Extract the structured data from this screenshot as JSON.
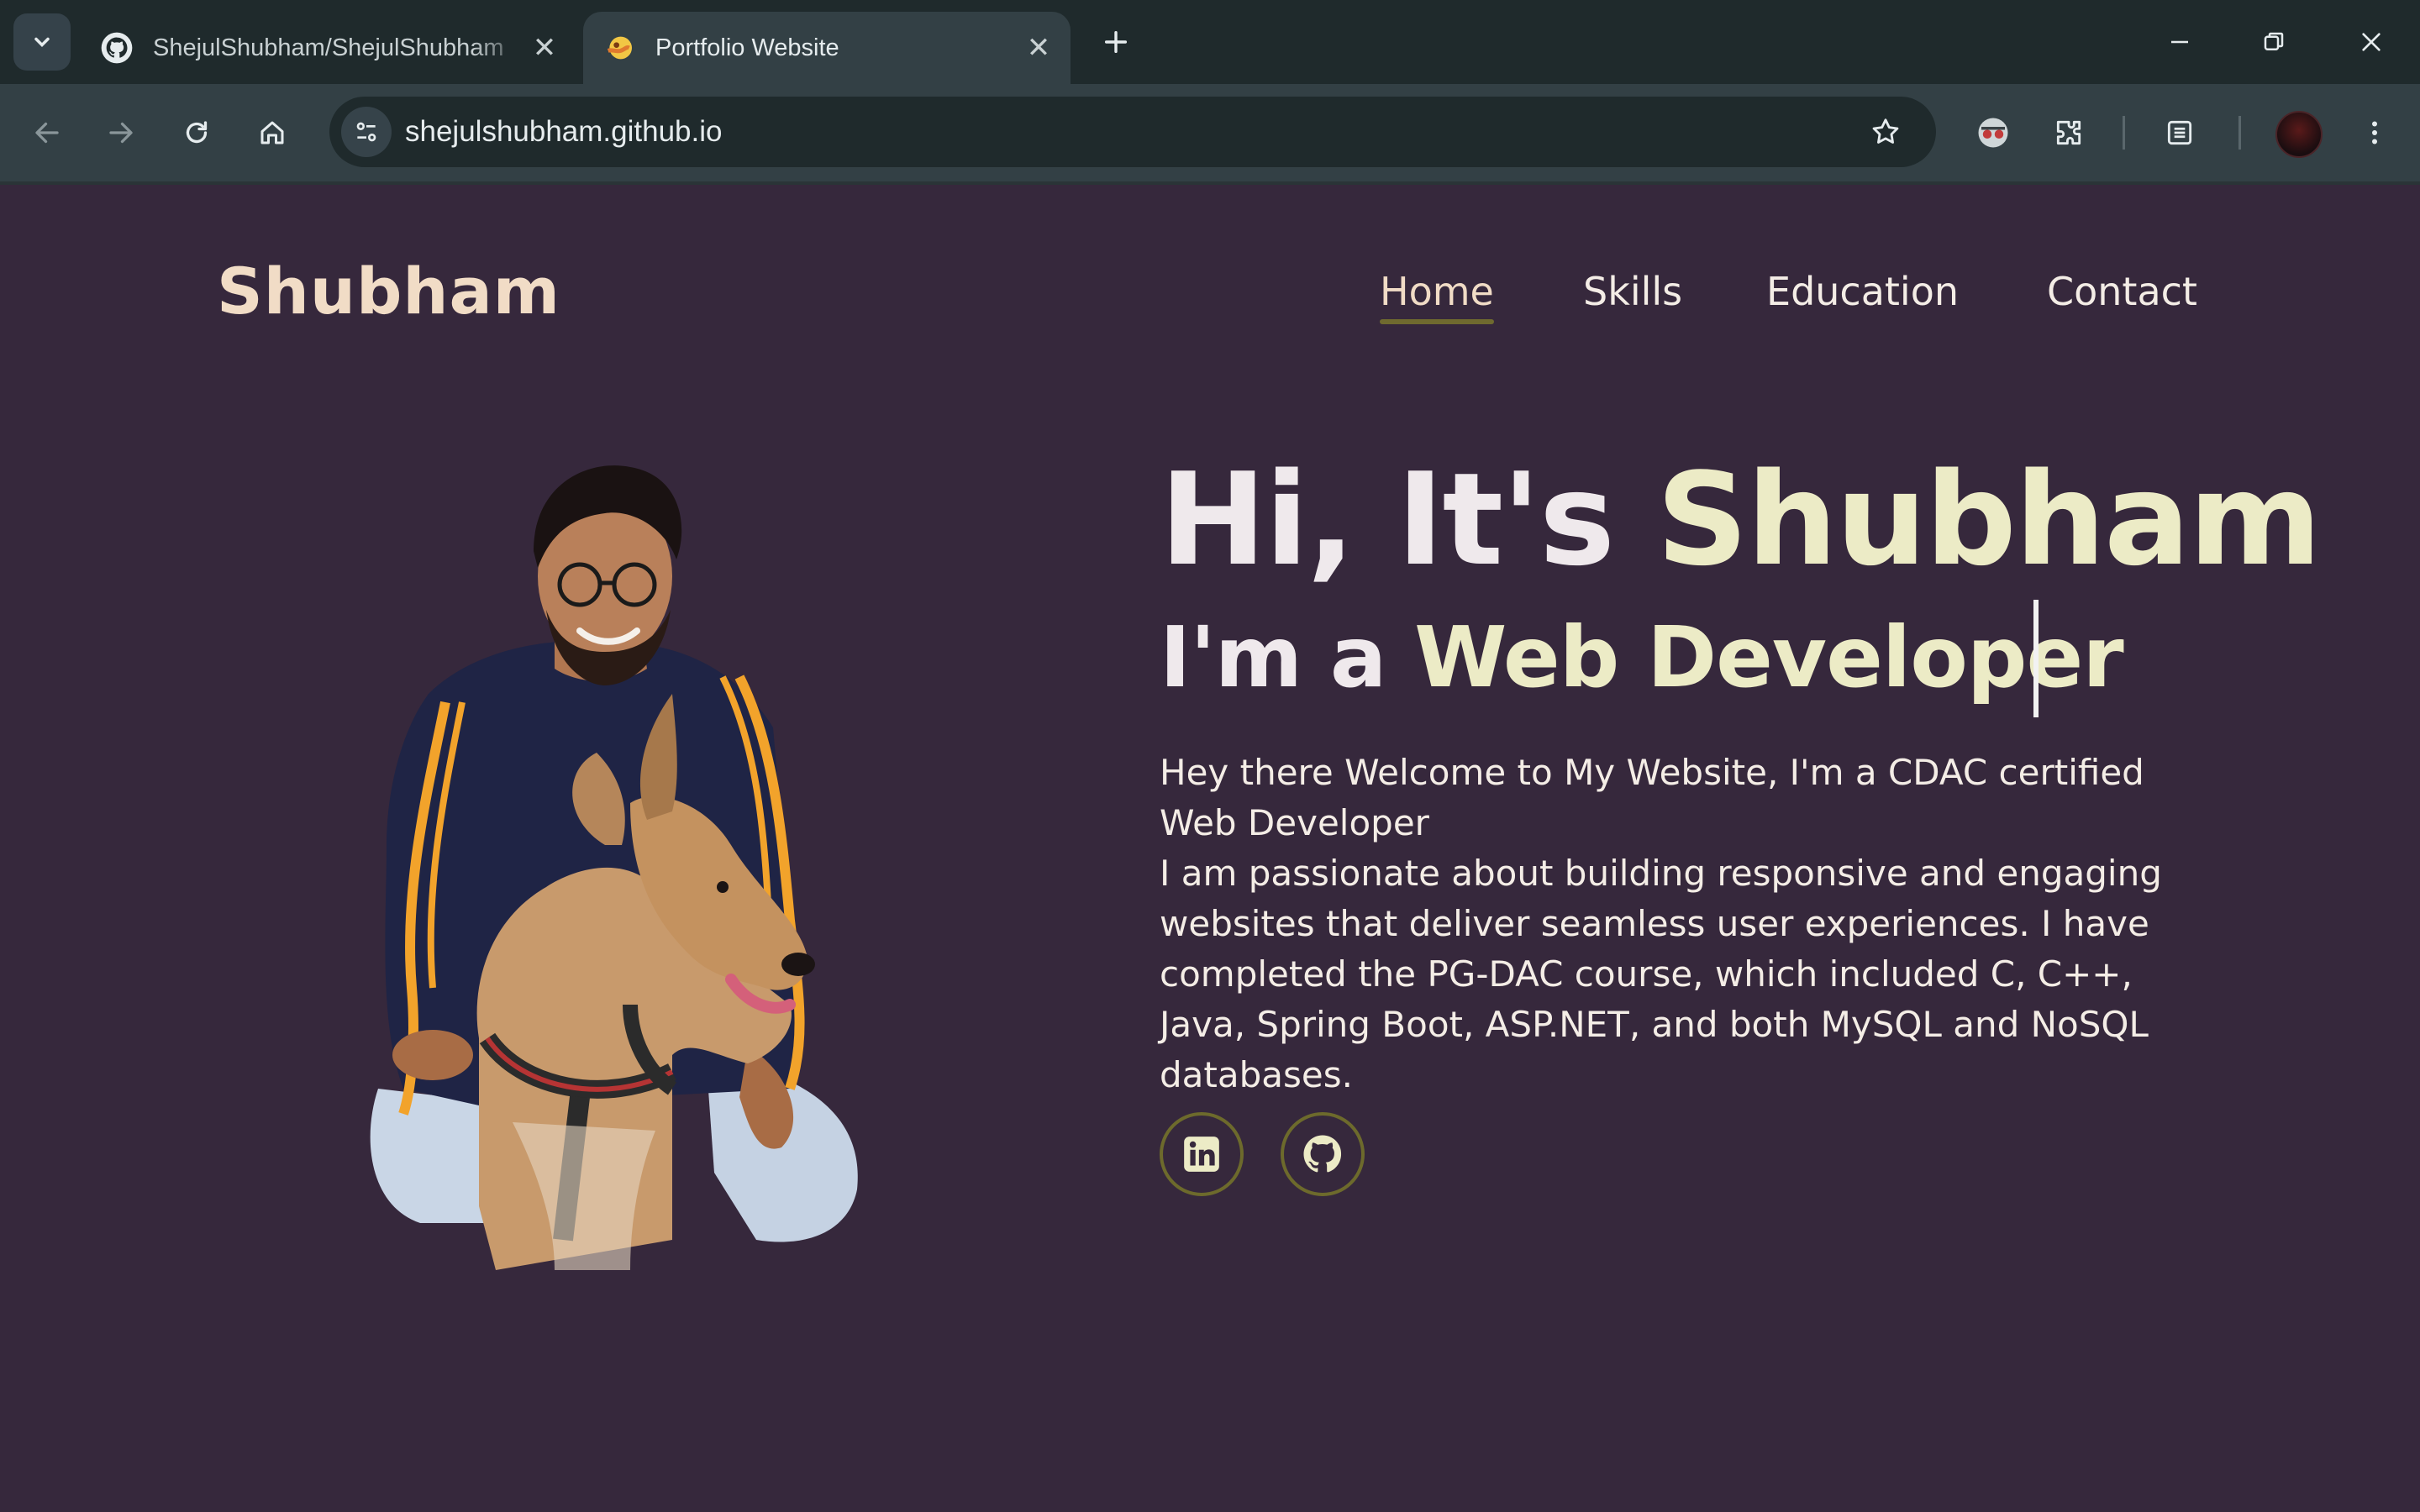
{
  "browser": {
    "tabs": [
      {
        "title": "ShejulShubham/ShejulShubham",
        "icon": "github-icon",
        "active": false
      },
      {
        "title": "Portfolio Website",
        "icon": "portfolio-favicon",
        "active": true
      }
    ],
    "url": "shejulshubham.github.io"
  },
  "site": {
    "logo": "Shubham",
    "nav": [
      {
        "label": "Home",
        "active": true
      },
      {
        "label": "Skills",
        "active": false
      },
      {
        "label": "Education",
        "active": false
      },
      {
        "label": "Contact",
        "active": false
      }
    ]
  },
  "hero": {
    "greeting_prefix": "Hi, It's ",
    "greeting_name": "Shubham",
    "role_prefix": "I'm a ",
    "role": "Web Developer",
    "intro_line1": "Hey there Welcome to My Website, I'm a CDAC certified Web Developer",
    "intro_line2": "I am passionate about building responsive and engaging websites that deliver seamless user experiences. I have completed the PG-DAC course, which included C, C++, Java, Spring Boot, ASP.NET, and both MySQL and NoSQL databases.",
    "social": [
      {
        "name": "linkedin-icon"
      },
      {
        "name": "github-icon"
      }
    ]
  },
  "colors": {
    "page_bg": "#36283c",
    "accent": "#ecebc6",
    "logo": "#f1dcc6",
    "ring": "#6d6a2c"
  }
}
